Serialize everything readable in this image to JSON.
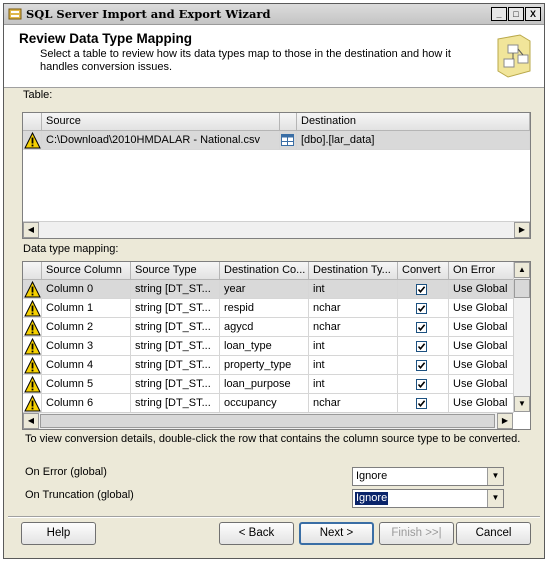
{
  "window": {
    "title": "SQL Server Import and Export Wizard",
    "minimize_glyph": "_",
    "maximize_glyph": "□",
    "close_glyph": "X"
  },
  "header": {
    "title": "Review Data Type Mapping",
    "description": "Select a table to review how its data types map to those in the destination and how it handles conversion issues."
  },
  "table_section": {
    "label": "Table:",
    "columns": [
      "Source",
      "Destination"
    ],
    "rows": [
      {
        "source": "C:\\Download\\2010HMDALAR - National.csv",
        "destination": "[dbo].[lar_data]"
      }
    ]
  },
  "mapping_section": {
    "label": "Data type mapping:",
    "columns": [
      "Source Column",
      "Source Type",
      "Destination Co...",
      "Destination Ty...",
      "Convert",
      "On Error"
    ],
    "rows": [
      {
        "source_column": "Column 0",
        "source_type": "string [DT_ST...",
        "destination_column": "year",
        "destination_type": "int",
        "convert": "checked",
        "on_error": "Use Global"
      },
      {
        "source_column": "Column 1",
        "source_type": "string [DT_ST...",
        "destination_column": "respid",
        "destination_type": "nchar",
        "convert": "checked",
        "on_error": "Use Global"
      },
      {
        "source_column": "Column 2",
        "source_type": "string [DT_ST...",
        "destination_column": "agycd",
        "destination_type": "nchar",
        "convert": "checked",
        "on_error": "Use Global"
      },
      {
        "source_column": "Column 3",
        "source_type": "string [DT_ST...",
        "destination_column": "loan_type",
        "destination_type": "int",
        "convert": "checked",
        "on_error": "Use Global"
      },
      {
        "source_column": "Column 4",
        "source_type": "string [DT_ST...",
        "destination_column": "property_type",
        "destination_type": "int",
        "convert": "checked",
        "on_error": "Use Global"
      },
      {
        "source_column": "Column 5",
        "source_type": "string [DT_ST...",
        "destination_column": "loan_purpose",
        "destination_type": "int",
        "convert": "checked",
        "on_error": "Use Global"
      },
      {
        "source_column": "Column 6",
        "source_type": "string [DT_ST...",
        "destination_column": "occupancy",
        "destination_type": "nchar",
        "convert": "checked",
        "on_error": "Use Global"
      }
    ]
  },
  "hint": "To view conversion details, double-click the row that contains the column source type to be converted.",
  "global_settings": {
    "on_error_label": "On Error (global)",
    "on_error_value": "Ignore",
    "on_truncation_label": "On Truncation (global)",
    "on_truncation_value": "Ignore"
  },
  "buttons": {
    "help": "Help",
    "back": "< Back",
    "next": "Next >",
    "finish": "Finish >>|",
    "cancel": "Cancel"
  },
  "icons": {
    "warning": "warning-icon",
    "table": "table-icon",
    "wizard": "wizard-icon"
  },
  "colors": {
    "selection": "#0a246a",
    "window_bg": "#ece9d8",
    "warning_yellow": "#f5d000"
  }
}
